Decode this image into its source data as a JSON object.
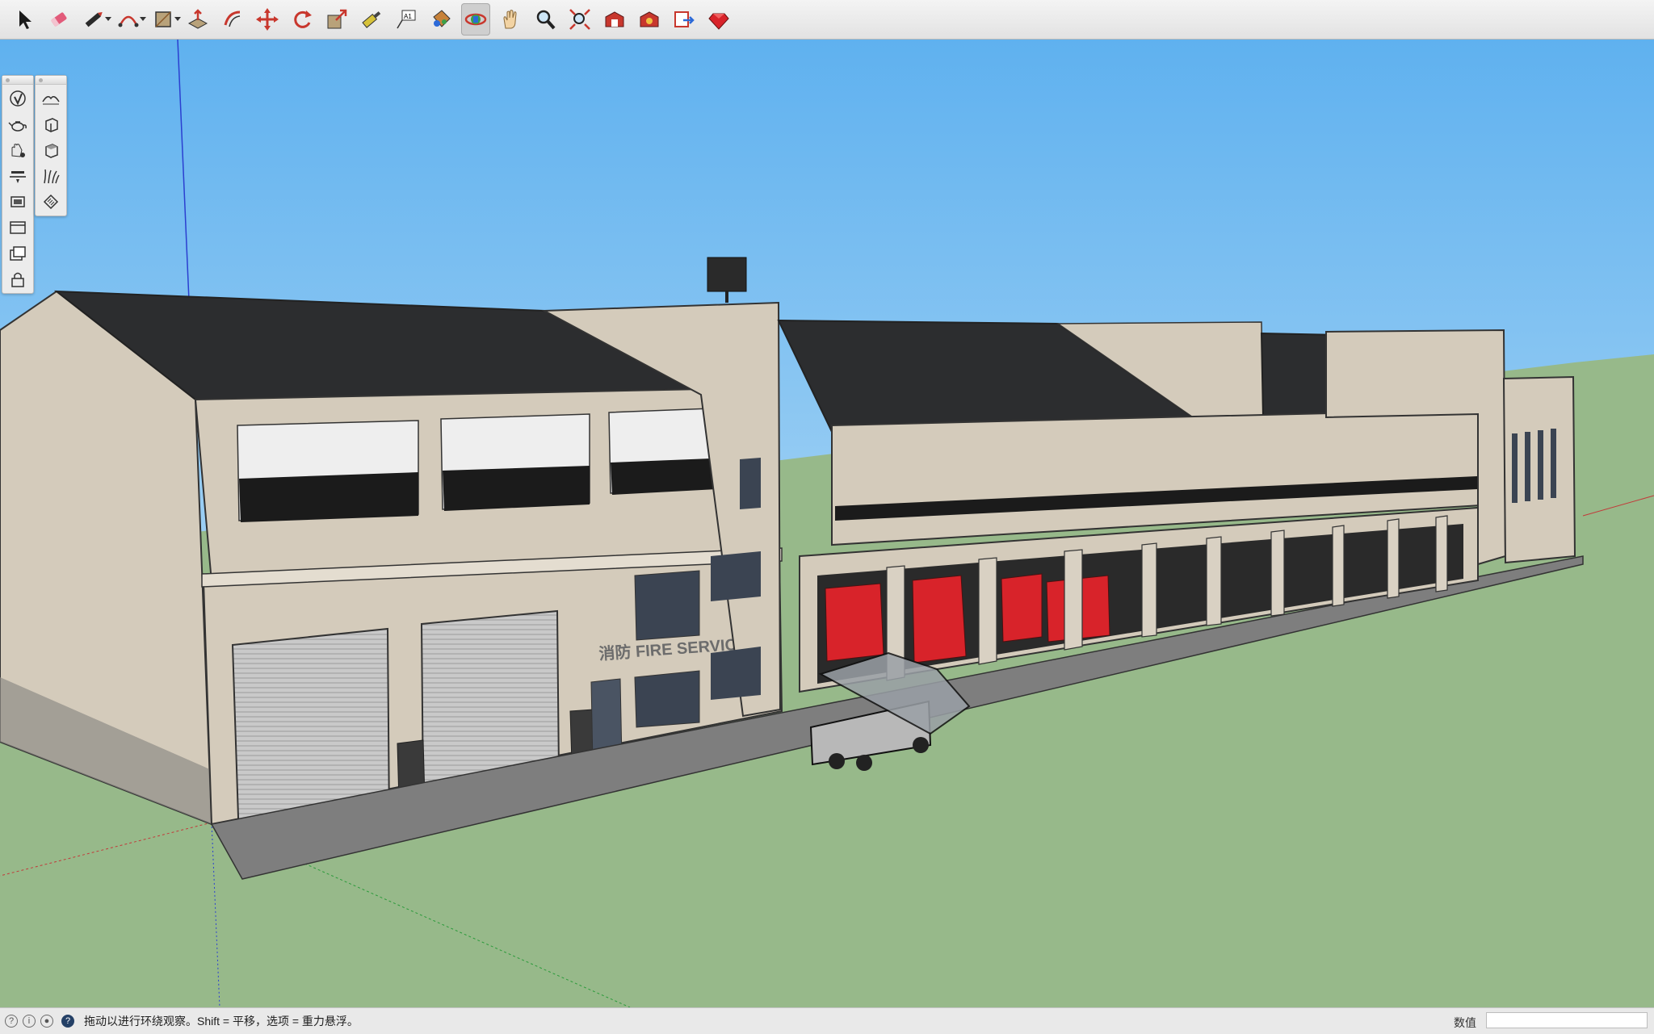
{
  "toolbar": {
    "tools": [
      {
        "name": "select-tool",
        "icon": "arrow-cursor-icon",
        "active": false,
        "dropdown": false
      },
      {
        "name": "eraser-tool",
        "icon": "eraser-icon",
        "active": false,
        "dropdown": false
      },
      {
        "name": "line-tool",
        "icon": "pencil-icon",
        "active": false,
        "dropdown": true
      },
      {
        "name": "arc-tool",
        "icon": "arc-icon",
        "active": false,
        "dropdown": true
      },
      {
        "name": "rectangle-tool",
        "icon": "rectangle-icon",
        "active": false,
        "dropdown": true
      },
      {
        "name": "push-pull-tool",
        "icon": "push-pull-icon",
        "active": false,
        "dropdown": false
      },
      {
        "name": "offset-tool",
        "icon": "offset-icon",
        "active": false,
        "dropdown": false
      },
      {
        "name": "move-tool",
        "icon": "move-arrows-icon",
        "active": false,
        "dropdown": false
      },
      {
        "name": "rotate-tool",
        "icon": "rotate-icon",
        "active": false,
        "dropdown": false
      },
      {
        "name": "scale-tool",
        "icon": "scale-icon",
        "active": false,
        "dropdown": false
      },
      {
        "name": "tape-measure-tool",
        "icon": "tape-measure-icon",
        "active": false,
        "dropdown": false
      },
      {
        "name": "text-tool",
        "icon": "text-label-icon",
        "active": false,
        "dropdown": false
      },
      {
        "name": "paint-bucket-tool",
        "icon": "paint-bucket-icon",
        "active": false,
        "dropdown": false
      },
      {
        "name": "orbit-tool",
        "icon": "orbit-icon",
        "active": true,
        "dropdown": false
      },
      {
        "name": "pan-tool",
        "icon": "hand-icon",
        "active": false,
        "dropdown": false
      },
      {
        "name": "zoom-tool",
        "icon": "magnifier-icon",
        "active": false,
        "dropdown": false
      },
      {
        "name": "zoom-extents-tool",
        "icon": "zoom-extents-icon",
        "active": false,
        "dropdown": false
      },
      {
        "name": "warehouse-tool",
        "icon": "warehouse-icon",
        "active": false,
        "dropdown": false
      },
      {
        "name": "extension-warehouse-tool",
        "icon": "extension-warehouse-icon",
        "active": false,
        "dropdown": false
      },
      {
        "name": "send-to-layout-tool",
        "icon": "send-to-layout-icon",
        "active": false,
        "dropdown": false
      },
      {
        "name": "extension-manager-tool",
        "icon": "ruby-gem-icon",
        "active": false,
        "dropdown": false
      }
    ]
  },
  "palettes": {
    "left": [
      {
        "name": "palette-tool-1",
        "icon": "v-check-icon"
      },
      {
        "name": "palette-tool-2",
        "icon": "teapot-icon"
      },
      {
        "name": "palette-tool-3",
        "icon": "paint-hand-icon"
      },
      {
        "name": "palette-tool-4",
        "icon": "section-plane-icon"
      },
      {
        "name": "palette-tool-5",
        "icon": "section-fill-icon"
      },
      {
        "name": "palette-tool-6",
        "icon": "window-frame-icon"
      },
      {
        "name": "palette-tool-7",
        "icon": "stacked-windows-icon"
      },
      {
        "name": "palette-tool-8",
        "icon": "lock-icon"
      }
    ],
    "right": [
      {
        "name": "palette-tool-9",
        "icon": "sandbox-terrain-icon"
      },
      {
        "name": "palette-tool-10",
        "icon": "box-front-icon"
      },
      {
        "name": "palette-tool-11",
        "icon": "box-top-icon"
      },
      {
        "name": "palette-tool-12",
        "icon": "grass-icon"
      },
      {
        "name": "palette-tool-13",
        "icon": "hatch-tag-icon"
      }
    ]
  },
  "scene": {
    "sign_text": "消防 FIRE SERVICES",
    "colors": {
      "sky_top": "#5fb1ef",
      "sky_bottom": "#d5ebf8",
      "ground": "#97b98a",
      "wall": "#d4cbbb",
      "roof": "#2c2d2f",
      "truck_red": "#d8232a"
    }
  },
  "status": {
    "text": "拖动以进行环绕观察。Shift = 平移，选项 = 重力悬浮。",
    "measure_label": "数值",
    "measure_value": ""
  }
}
